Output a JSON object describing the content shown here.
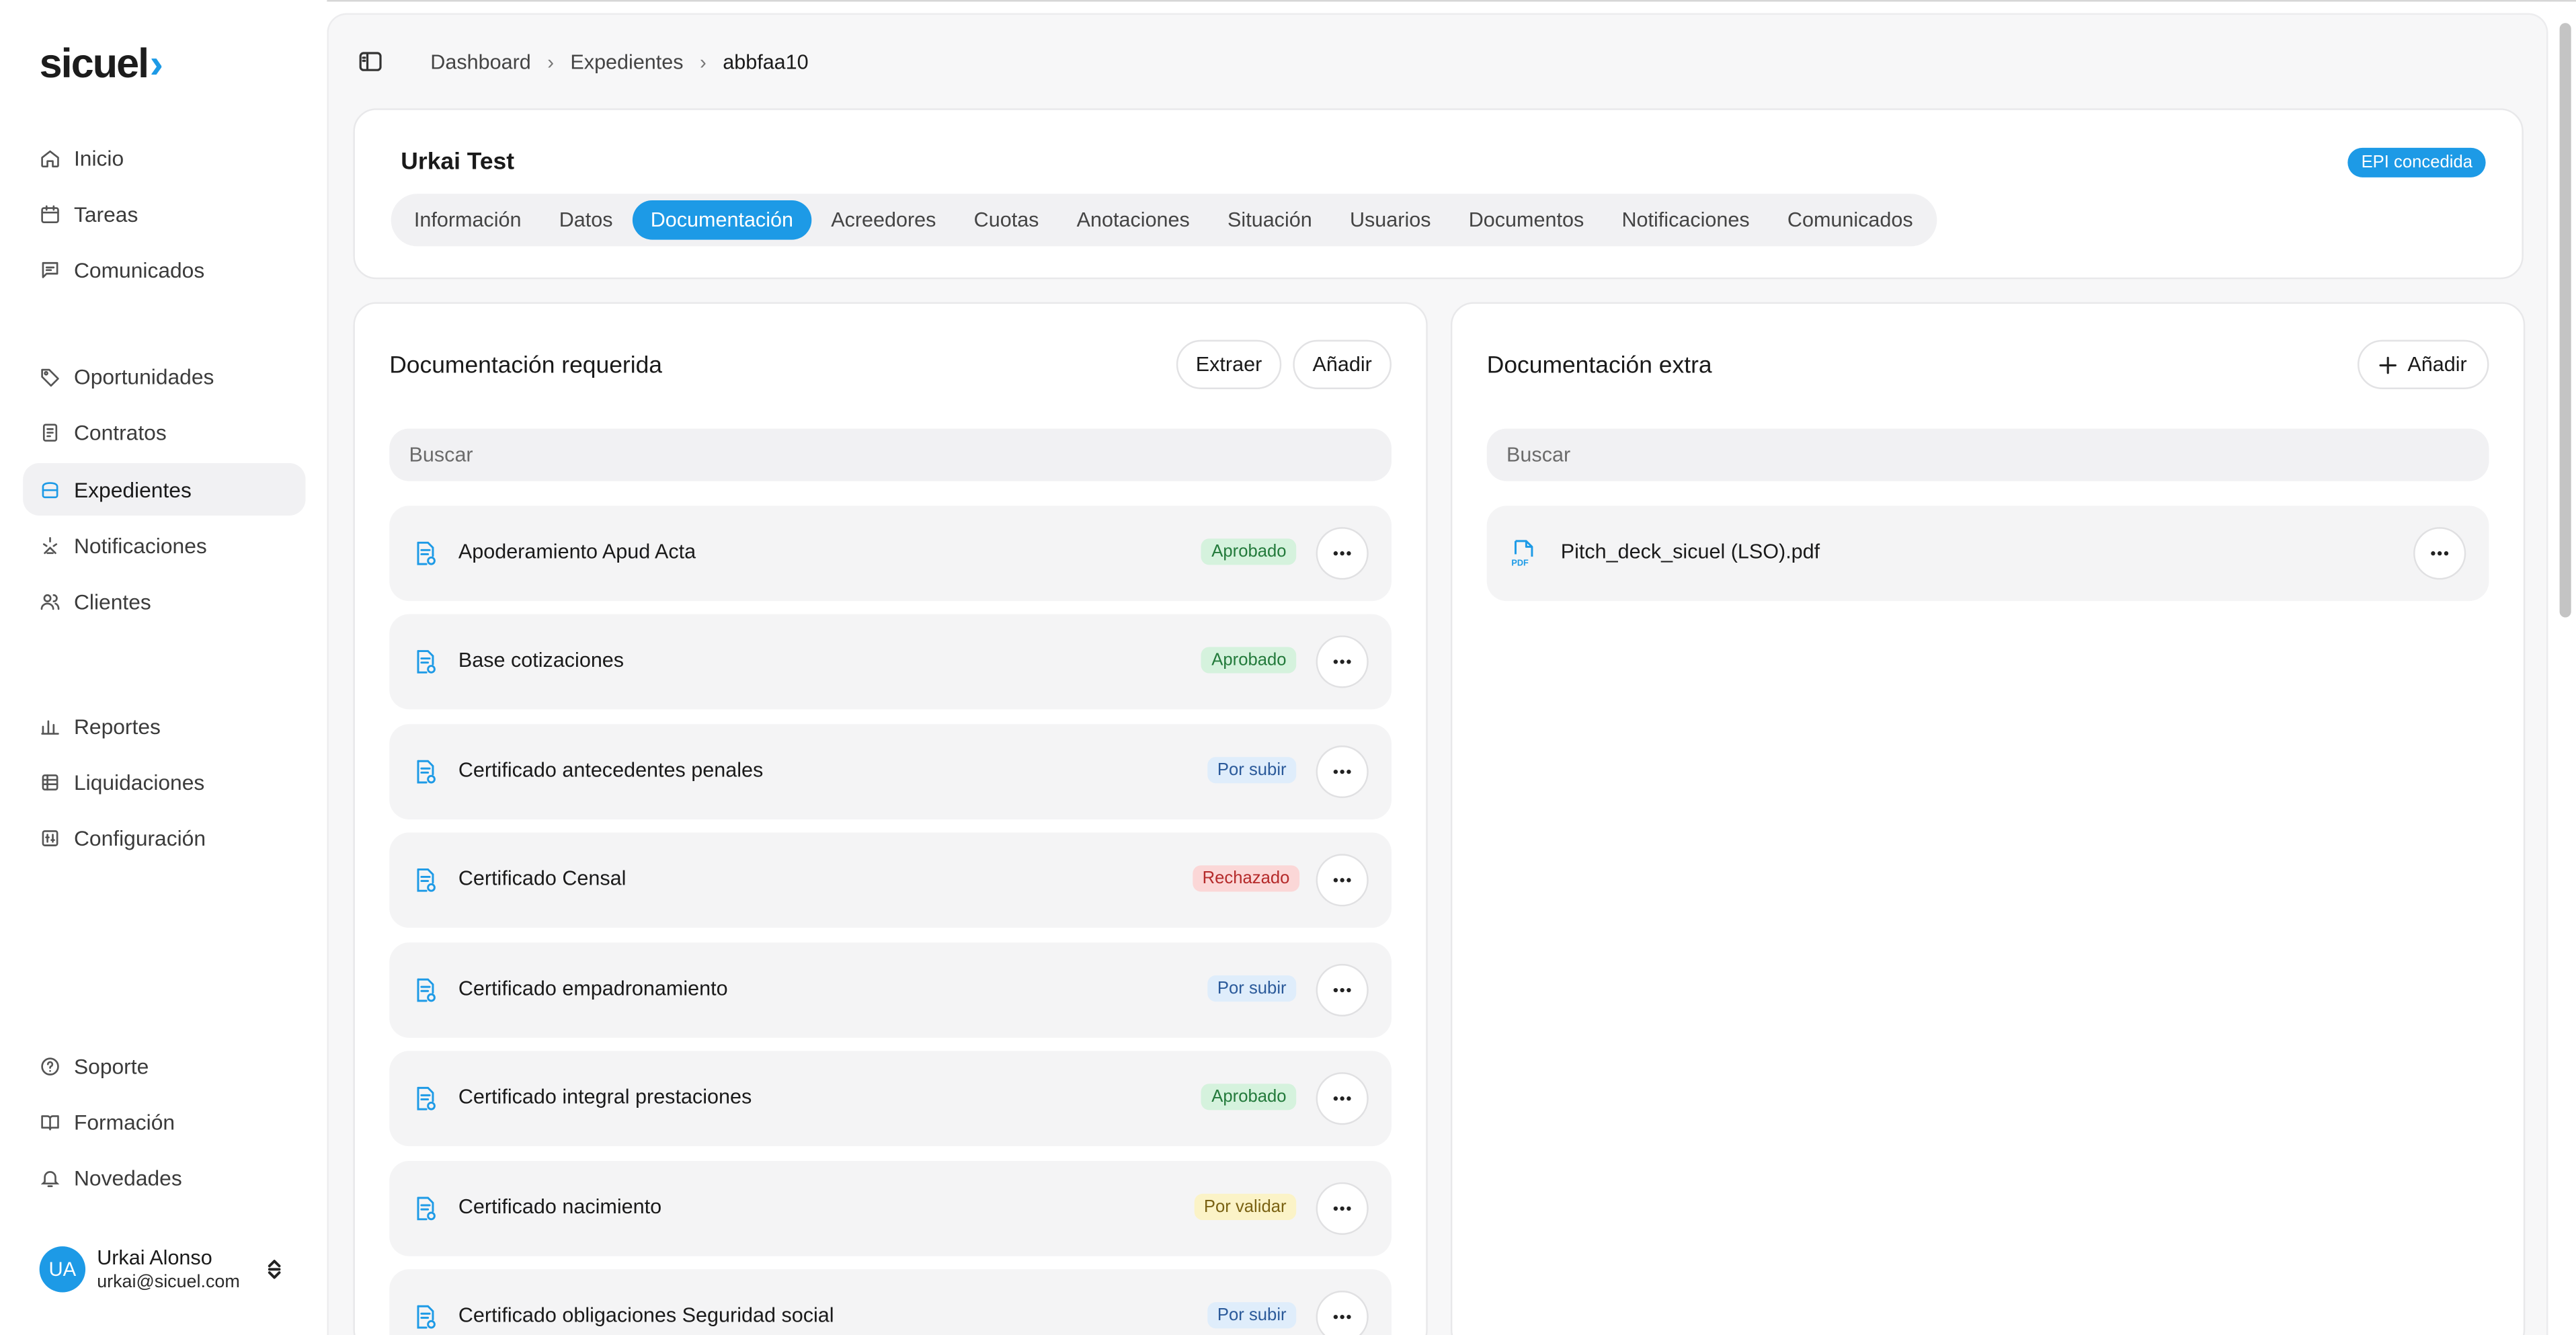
{
  "brand": {
    "logo": "sicuel",
    "logo_chevron": "›",
    "accent": "#1d9ae6"
  },
  "sidebar": {
    "items": [
      {
        "label": "Inicio",
        "icon": "home-icon"
      },
      {
        "label": "Tareas",
        "icon": "calendar-icon"
      },
      {
        "label": "Comunicados",
        "icon": "message-icon"
      },
      {
        "label": "Oportunidades",
        "icon": "tag-icon"
      },
      {
        "label": "Contratos",
        "icon": "contract-icon"
      },
      {
        "label": "Expedientes",
        "icon": "folder-icon",
        "active": true
      },
      {
        "label": "Notificaciones",
        "icon": "notification-icon"
      },
      {
        "label": "Clientes",
        "icon": "users-icon"
      },
      {
        "label": "Reportes",
        "icon": "chart-icon"
      },
      {
        "label": "Liquidaciones",
        "icon": "stack-icon"
      },
      {
        "label": "Configuración",
        "icon": "settings-icon"
      },
      {
        "label": "Soporte",
        "icon": "help-icon"
      },
      {
        "label": "Formación",
        "icon": "book-icon"
      },
      {
        "label": "Novedades",
        "icon": "bell-icon"
      }
    ],
    "user": {
      "initials": "UA",
      "name": "Urkai Alonso",
      "email": "urkai@sicuel.com"
    }
  },
  "breadcrumb": {
    "items": [
      "Dashboard",
      "Expedientes",
      "abbfaa10"
    ],
    "separator": "›"
  },
  "header": {
    "title": "Urkai Test",
    "badge": "EPI concedida",
    "tabs": [
      "Información",
      "Datos",
      "Documentación",
      "Acreedores",
      "Cuotas",
      "Anotaciones",
      "Situación",
      "Usuarios",
      "Documentos",
      "Notificaciones",
      "Comunicados"
    ],
    "active_tab": "Documentación"
  },
  "required_docs": {
    "title": "Documentación requerida",
    "extract_label": "Extraer",
    "add_label": "Añadir",
    "search_placeholder": "Buscar",
    "items": [
      {
        "name": "Apoderamiento Apud Acta",
        "status": "Aprobado"
      },
      {
        "name": "Base cotizaciones",
        "status": "Aprobado"
      },
      {
        "name": "Certificado antecedentes penales",
        "status": "Por subir"
      },
      {
        "name": "Certificado Censal",
        "status": "Rechazado"
      },
      {
        "name": "Certificado empadronamiento",
        "status": "Por subir"
      },
      {
        "name": "Certificado integral prestaciones",
        "status": "Aprobado"
      },
      {
        "name": "Certificado nacimiento",
        "status": "Por validar"
      },
      {
        "name": "Certificado obligaciones Seguridad social",
        "status": "Por subir"
      }
    ]
  },
  "extra_docs": {
    "title": "Documentación extra",
    "add_label": "Añadir",
    "search_placeholder": "Buscar",
    "items": [
      {
        "name": "Pitch_deck_sicuel (LSO).pdf",
        "icon": "pdf-icon"
      }
    ]
  }
}
